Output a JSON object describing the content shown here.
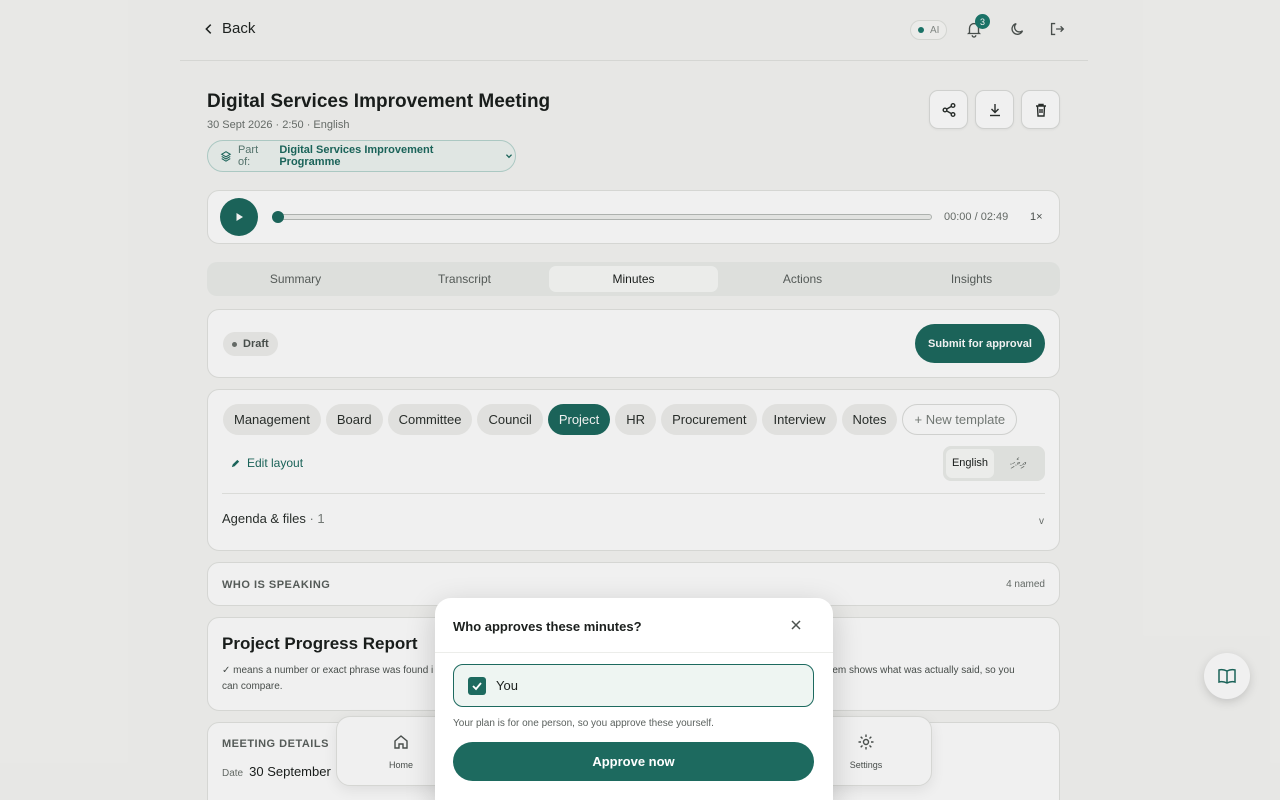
{
  "topbar": {
    "back_label": "Back",
    "ai_label": "AI",
    "notification_count": "3"
  },
  "meeting": {
    "title": "Digital Services Improvement Meeting",
    "meta": "30 Sept 2026 · 2:50 · English",
    "part_of_label": "Part of:",
    "part_of_value": "Digital Services Improvement Programme"
  },
  "player": {
    "time": "00:00 / 02:49",
    "speed": "1×",
    "progress": 0
  },
  "tabs": [
    {
      "label": "Summary"
    },
    {
      "label": "Transcript"
    },
    {
      "label": "Minutes",
      "active": true
    },
    {
      "label": "Actions"
    },
    {
      "label": "Insights"
    }
  ],
  "status": {
    "draft_label": "Draft",
    "submit_label": "Submit for approval"
  },
  "templates": {
    "items": [
      "Management",
      "Board",
      "Committee",
      "Council",
      "Project",
      "HR",
      "Procurement",
      "Interview",
      "Notes"
    ],
    "active": "Project",
    "new_label": "+ New template",
    "edit_layout": "Edit layout",
    "lang_options": [
      "English",
      "ދިވެހި"
    ],
    "lang_active": "English",
    "agenda_label": "Agenda & files",
    "agenda_count": "· 1",
    "chevron": "v"
  },
  "speakers": {
    "label": "WHO IS SPEAKING",
    "count": "4 named"
  },
  "report": {
    "title": "Project Progress Report",
    "note_part1": "✓ means a number or exact phrase was found i",
    "note_part2": "can compare.",
    "note_part3": "ch item shows what was actually said, so you"
  },
  "details": {
    "label": "MEETING DETAILS",
    "date_label": "Date",
    "date_value": "30 September"
  },
  "bottom_nav": {
    "home": "Home",
    "settings": "Settings"
  },
  "modal": {
    "title": "Who approves these minutes?",
    "option_label": "You",
    "option_checked": true,
    "hint": "Your plan is for one person, so you approve these yourself.",
    "button": "Approve now"
  },
  "colors": {
    "accent": "#1d6a5f",
    "background": "#f6f6f4"
  }
}
